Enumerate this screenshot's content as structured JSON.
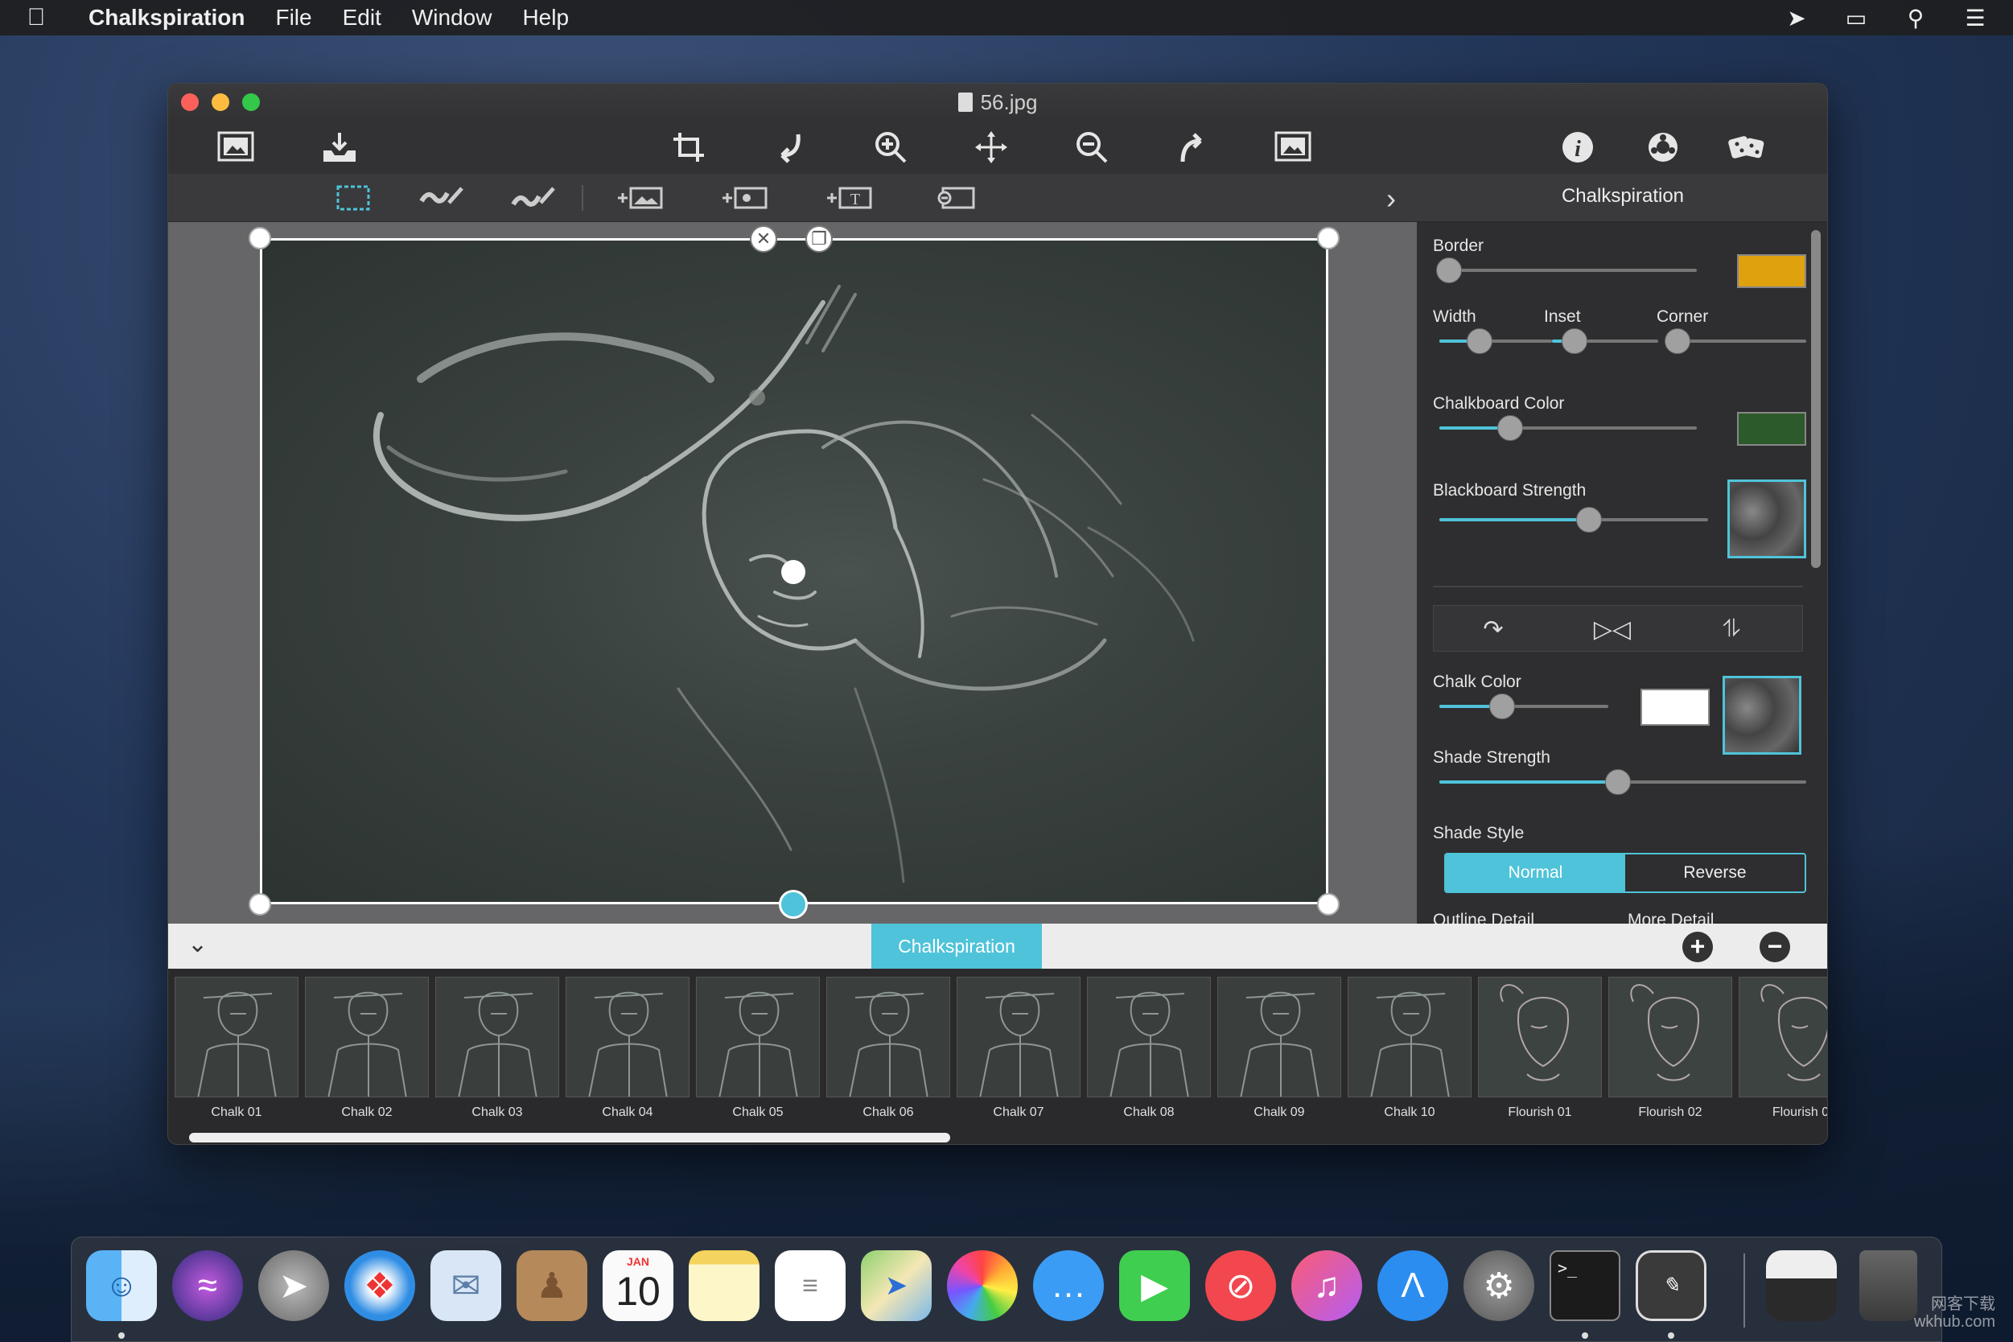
{
  "menubar": {
    "apple_icon": "apple-icon",
    "app_name": "Chalkspiration",
    "items": [
      "File",
      "Edit",
      "Window",
      "Help"
    ],
    "status_icons": [
      "location-icon",
      "display-icon",
      "search-icon",
      "list-icon"
    ]
  },
  "window": {
    "title": "56.jpg",
    "toolbar": {
      "left": [
        "open-image-icon",
        "save-icon"
      ],
      "center": [
        "crop-icon",
        "undo-icon",
        "zoom-in-icon",
        "move-icon",
        "zoom-out-icon",
        "redo-icon",
        "fit-image-icon"
      ],
      "right": [
        "info-icon",
        "settings-icon",
        "randomize-icon"
      ]
    },
    "toolbar2": [
      "select-icon",
      "brush-add-icon",
      "brush-remove-icon",
      "add-image-icon",
      "add-effect-icon",
      "add-text-icon",
      "remove-layer-icon"
    ]
  },
  "panel": {
    "header": "Chalkspiration",
    "border_label": "Border",
    "border_color": "#e0a10f",
    "width_label": "Width",
    "inset_label": "Inset",
    "corner_label": "Corner",
    "chalkboard_color_label": "Chalkboard Color",
    "chalkboard_color": "#2c5a2a",
    "blackboard_strength_label": "Blackboard Strength",
    "chalk_color_label": "Chalk Color",
    "chalk_color": "#ffffff",
    "shade_strength_label": "Shade Strength",
    "shade_style_label": "Shade Style",
    "shade_style_options": [
      "Normal",
      "Reverse"
    ],
    "shade_style_selected": "Normal",
    "outline_detail_label": "Outline Detail",
    "more_detail_label": "More Detail",
    "orient_icons": [
      "rotate-icon",
      "flip-horizontal-icon",
      "flip-vertical-icon"
    ],
    "slider_levels": {
      "border": 0.0,
      "width": 0.35,
      "inset": 0.2,
      "corner": 0.05,
      "chalkboard_color": 0.25,
      "blackboard_strength": 0.56,
      "chalk_color": 0.37,
      "shade_strength": 0.49
    }
  },
  "strip": {
    "tab_label": "Chalkspiration",
    "add_label": "+",
    "remove_label": "−",
    "presets": [
      "Chalk 01",
      "Chalk 02",
      "Chalk 03",
      "Chalk 04",
      "Chalk 05",
      "Chalk 06",
      "Chalk 07",
      "Chalk 08",
      "Chalk 09",
      "Chalk 10",
      "Flourish 01",
      "Flourish 02",
      "Flourish 0"
    ]
  },
  "dock": {
    "icons": [
      "finder-icon",
      "siri-icon",
      "launchpad-icon",
      "safari-icon",
      "mail-icon",
      "contacts-icon",
      "calendar-icon",
      "notes-icon",
      "reminders-icon",
      "maps-icon",
      "photos-icon",
      "messages-icon",
      "facetime-icon",
      "news-icon",
      "music-icon",
      "app-store-icon",
      "system-preferences-icon",
      "terminal-icon",
      "chalkspiration-icon",
      "downloads-stack-icon",
      "trash-icon"
    ],
    "calendar_month": "JAN",
    "calendar_day": "10",
    "terminal_prompt": ">_"
  },
  "watermark": {
    "line1": "网客下载",
    "line2": "wkhub.com"
  }
}
